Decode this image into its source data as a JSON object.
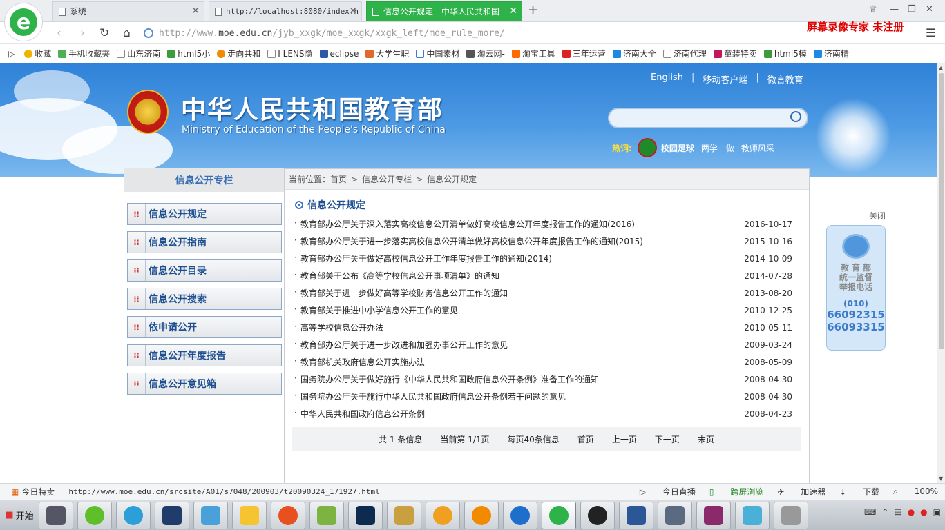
{
  "browser": {
    "tabs": [
      {
        "label": "系统"
      },
      {
        "label": "http://localhost:8080/index.h"
      },
      {
        "label": "信息公开规定 - 中华人民共和国"
      }
    ],
    "url_prefix": "http://www.",
    "url_host": "moe.edu.cn",
    "url_path": "/jyb_xxgk/moe_xxgk/xxgk_left/moe_rule_more/",
    "watermark": "屏幕录像专家 未注册",
    "bookmarks": [
      "收藏",
      "手机收藏夹",
      "山东济南",
      "html5小",
      "走向共和",
      "I LENS隐",
      "eclipse",
      "大学生职",
      "中国素材",
      "淘云网-",
      "淘宝工具",
      "三年运营",
      "济南大全",
      "济南代理",
      "童装特卖",
      "html5模",
      "济南精"
    ]
  },
  "site": {
    "title_cn": "中华人民共和国教育部",
    "title_en": "Ministry of Education of the People's Republic of China",
    "top_links": [
      "English",
      "移动客户端",
      "微言教育"
    ],
    "hot_label": "热词:",
    "hot_words": [
      "校园足球",
      "两学一做",
      "教师风采"
    ]
  },
  "sidebar": {
    "heading": "信息公开专栏",
    "items": [
      "信息公开规定",
      "信息公开指南",
      "信息公开目录",
      "信息公开搜索",
      "依申请公开",
      "信息公开年度报告",
      "信息公开意见箱"
    ]
  },
  "main": {
    "breadcrumb": [
      "当前位置：首页",
      ">",
      "信息公开专栏",
      ">",
      "信息公开规定"
    ],
    "section_title": "信息公开规定",
    "rows": [
      {
        "title": "教育部办公厅关于深入落实高校信息公开清单做好高校信息公开年度报告工作的通知(2016)",
        "date": "2016-10-17"
      },
      {
        "title": "教育部办公厅关于进一步落实高校信息公开清单做好高校信息公开年度报告工作的通知(2015)",
        "date": "2015-10-16"
      },
      {
        "title": "教育部办公厅关于做好高校信息公开工作年度报告工作的通知(2014)",
        "date": "2014-10-09"
      },
      {
        "title": "教育部关于公布《高等学校信息公开事项清单》的通知",
        "date": "2014-07-28"
      },
      {
        "title": "教育部关于进一步做好高等学校财务信息公开工作的通知",
        "date": "2013-08-20"
      },
      {
        "title": "教育部关于推进中小学信息公开工作的意见",
        "date": "2010-12-25"
      },
      {
        "title": "高等学校信息公开办法",
        "date": "2010-05-11"
      },
      {
        "title": "教育部办公厅关于进一步改进和加强办事公开工作的意见",
        "date": "2009-03-24"
      },
      {
        "title": "教育部机关政府信息公开实施办法",
        "date": "2008-05-09"
      },
      {
        "title": "国务院办公厅关于做好施行《中华人民共和国政府信息公开条例》准备工作的通知",
        "date": "2008-04-30"
      },
      {
        "title": "国务院办公厅关于施行中华人民共和国政府信息公开条例若干问题的意见",
        "date": "2008-04-30"
      },
      {
        "title": "中华人民共和国政府信息公开条例",
        "date": "2008-04-23"
      }
    ],
    "pager": [
      "共 1 条信息",
      "当前第 1/1页",
      "每页40条信息",
      "首页",
      "上一页",
      "下一页",
      "末页"
    ]
  },
  "widget": {
    "close": "关闭",
    "lines": [
      "教 育 部",
      "统一监督",
      "举报电话"
    ],
    "area": "(010)",
    "numbers": [
      "66092315",
      "66093315"
    ]
  },
  "status": {
    "left": "今日特卖",
    "url": "http://www.moe.edu.cn/srcsite/A01/s7048/200903/t20090324_171927.html",
    "items": [
      "今日直播",
      "跨屏浏览",
      "加速器",
      "下载"
    ],
    "zoom": "100%"
  },
  "taskbar": {
    "start": "开始"
  }
}
